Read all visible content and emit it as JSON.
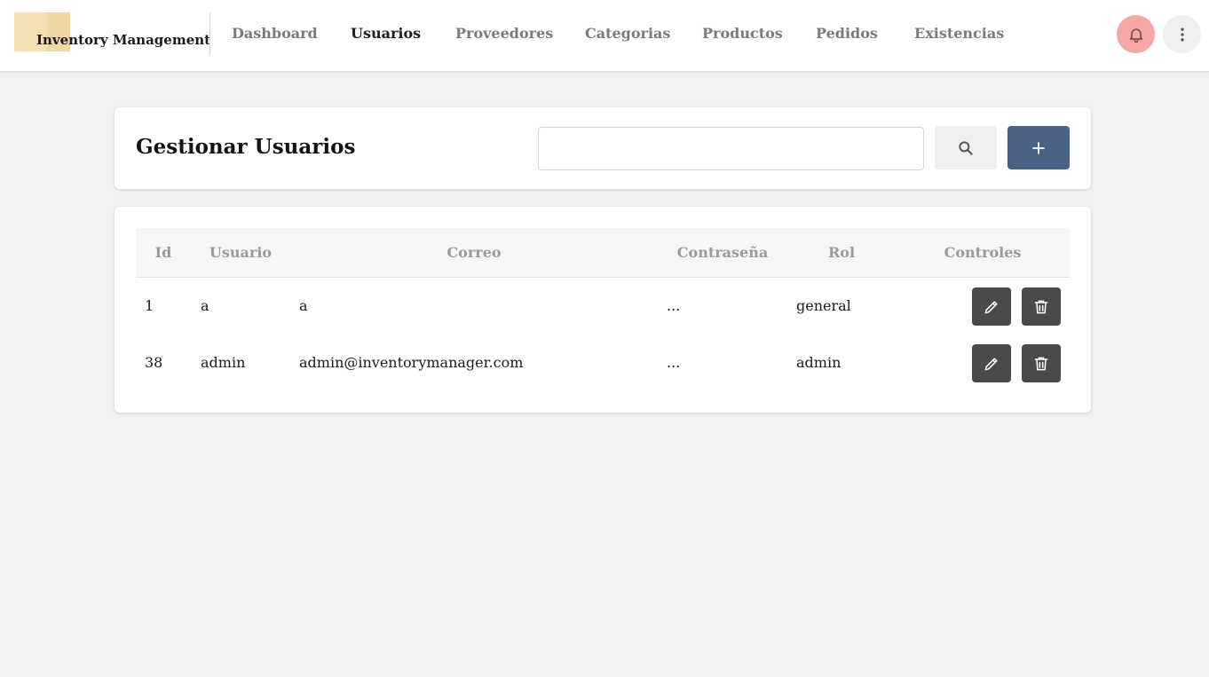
{
  "app": {
    "brand": "Inventory Management"
  },
  "nav": {
    "items": [
      {
        "label": "Dashboard",
        "active": false
      },
      {
        "label": "Usuarios",
        "active": true
      },
      {
        "label": "Proveedores",
        "active": false
      },
      {
        "label": "Categorias",
        "active": false
      },
      {
        "label": "Productos",
        "active": false
      },
      {
        "label": "Pedidos",
        "active": false
      },
      {
        "label": "Existencias",
        "active": false
      }
    ]
  },
  "actions": {
    "bell_icon": "bell-icon",
    "more_icon": "more-vertical-icon",
    "bell_color": "#f7a6a6"
  },
  "page": {
    "title": "Gestionar Usuarios",
    "search": {
      "value": "",
      "placeholder": ""
    },
    "search_icon": "search-icon",
    "add_icon": "plus-icon",
    "accent": "#4a6283"
  },
  "table": {
    "columns": [
      "Id",
      "Usuario",
      "Correo",
      "Contraseña",
      "Rol",
      "Controles"
    ],
    "rows": [
      {
        "id": "1",
        "usuario": "a",
        "correo": "a",
        "contrasena": "...",
        "rol": "general"
      },
      {
        "id": "38",
        "usuario": "admin",
        "correo": "admin@inventorymanager.com",
        "contrasena": "...",
        "rol": "admin"
      }
    ],
    "edit_icon": "pencil-icon",
    "delete_icon": "trash-icon"
  }
}
